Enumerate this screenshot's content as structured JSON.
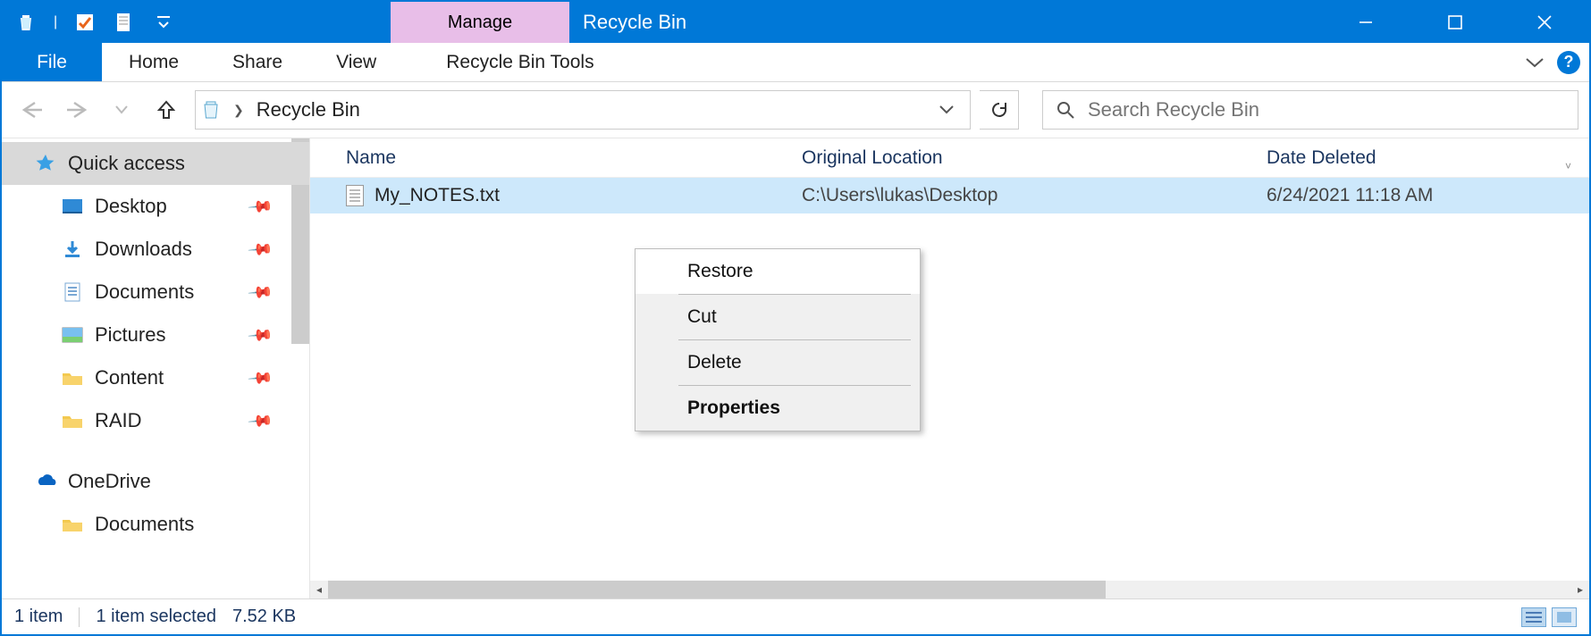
{
  "titlebar": {
    "contextual_tab": "Manage",
    "title": "Recycle Bin"
  },
  "ribbon": {
    "file": "File",
    "tabs": [
      "Home",
      "Share",
      "View",
      "Recycle Bin Tools"
    ]
  },
  "address": {
    "location": "Recycle Bin"
  },
  "search": {
    "placeholder": "Search Recycle Bin"
  },
  "sidebar": {
    "quick_access": "Quick access",
    "items": [
      {
        "label": "Desktop",
        "icon": "desktop"
      },
      {
        "label": "Downloads",
        "icon": "downloads"
      },
      {
        "label": "Documents",
        "icon": "documents"
      },
      {
        "label": "Pictures",
        "icon": "pictures"
      },
      {
        "label": "Content",
        "icon": "folder"
      },
      {
        "label": "RAID",
        "icon": "folder"
      }
    ],
    "onedrive": {
      "label": "OneDrive",
      "children": [
        "Documents"
      ]
    }
  },
  "columns": {
    "name": "Name",
    "location": "Original Location",
    "date": "Date Deleted"
  },
  "rows": [
    {
      "name": "My_NOTES.txt",
      "location": "C:\\Users\\lukas\\Desktop",
      "date": "6/24/2021 11:18 AM"
    }
  ],
  "context_menu": {
    "items": [
      "Restore",
      "Cut",
      "Delete",
      "Properties"
    ],
    "default_index": 3,
    "hover_index": 0
  },
  "status": {
    "count": "1 item",
    "selection": "1 item selected",
    "size": "7.52 KB"
  }
}
